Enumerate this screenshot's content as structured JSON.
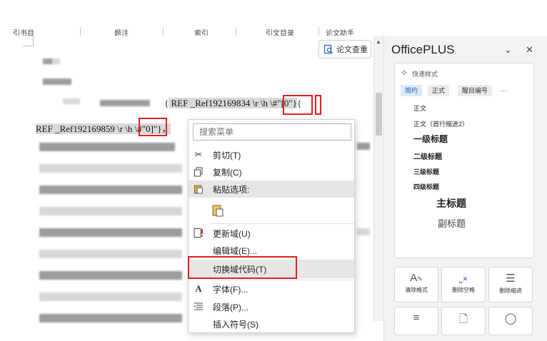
{
  "ribbon": {
    "tabs": [
      "引书目",
      "题注",
      "索引",
      "引文目录",
      "论文助手"
    ]
  },
  "document": {
    "check_button_label": "论文查重",
    "field_line_1": "{ REF  _Ref192169834 \\r \\h  \\#\"[0\" }{",
    "field_line_1_parts": {
      "brace_open": "{",
      "ref": " REF  _Ref192169834 \\r \\h ",
      "code": "\\#\"[0\"",
      "tail": "}",
      "next": "{"
    },
    "field_line_2_parts": {
      "ref": "REF  _Ref192169859 \\r \\h ",
      "code": "\\#\"0]\"",
      "tail": "}，"
    }
  },
  "context_menu": {
    "search_placeholder": "搜索菜单",
    "items": [
      {
        "icon": "scissors-icon",
        "label": "剪切(T)"
      },
      {
        "icon": "copy-icon",
        "label": "复制(C)"
      },
      {
        "icon": "paste-icon",
        "label": "粘贴选项:"
      },
      {
        "icon": "update-field-icon",
        "label": "更新域(U)"
      },
      {
        "icon": "",
        "label": "编辑域(E)..."
      },
      {
        "icon": "",
        "label": "切换域代码(T)"
      },
      {
        "icon": "font-icon",
        "label": "字体(F)..."
      },
      {
        "icon": "paragraph-icon",
        "label": "段落(P)..."
      },
      {
        "icon": "",
        "label": "插入符号(S)"
      }
    ],
    "highlighted": "切换域代码(T)"
  },
  "officeplus": {
    "title": "OfficePLUS",
    "quick_styles_label": "快速样式",
    "style_tabs": [
      "简约",
      "正式",
      "醒目编号",
      "···"
    ],
    "active_tab": "简约",
    "styles": [
      {
        "label": "正文"
      },
      {
        "label": "正文（首行缩进2）"
      },
      {
        "label": "一级标题"
      },
      {
        "label": "二级标题"
      },
      {
        "label": "三级标题"
      },
      {
        "label": "四级标题"
      },
      {
        "label": "主标题"
      },
      {
        "label": "副标题"
      }
    ],
    "tools": [
      {
        "icon": "clear-format-icon",
        "label": "清除格式"
      },
      {
        "icon": "delete-space-icon",
        "label": "删除空格"
      },
      {
        "icon": "delete-indent-icon",
        "label": "删除缩进"
      }
    ]
  },
  "colors": {
    "accent": "#1a5fb4",
    "annotation_red": "#e02020",
    "menu_highlight": "#e6e6e6"
  }
}
